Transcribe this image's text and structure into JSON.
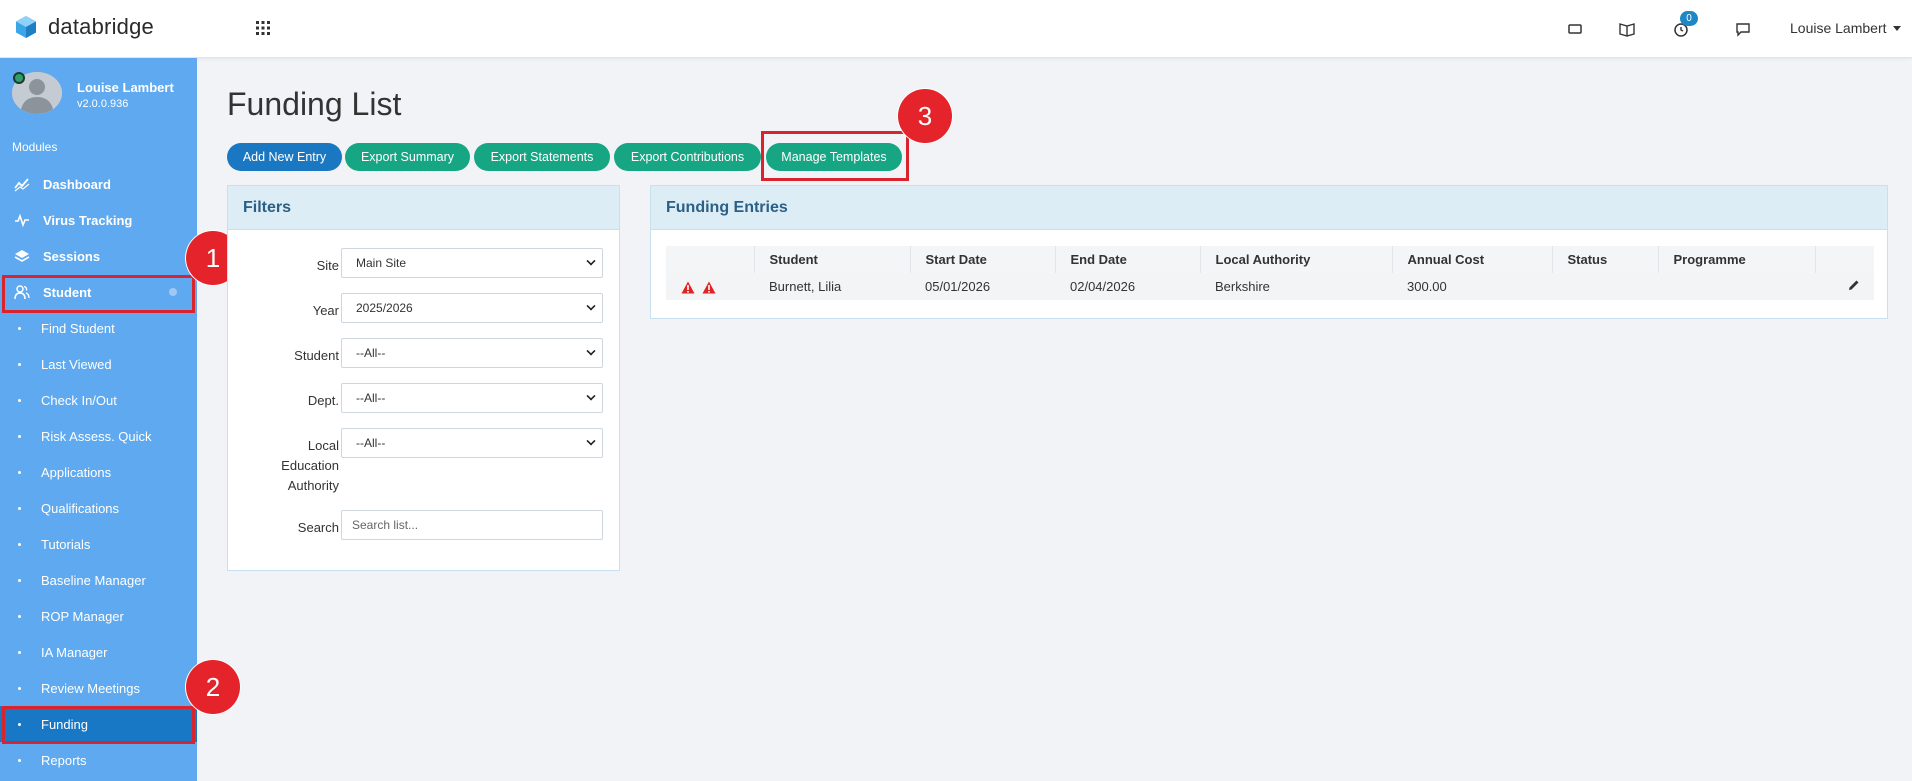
{
  "app": {
    "name": "databridge"
  },
  "topbar": {
    "notification_count": "0",
    "user_name": "Louise Lambert"
  },
  "sidebar": {
    "profile_name": "Louise Lambert",
    "version": "v2.0.0.936",
    "modules_label": "Modules",
    "items": [
      {
        "label": "Dashboard",
        "icon": "chart-line-icon"
      },
      {
        "label": "Virus Tracking",
        "icon": "pulse-icon"
      },
      {
        "label": "Sessions",
        "icon": "layers-icon"
      },
      {
        "label": "Student",
        "icon": "users-icon"
      }
    ],
    "sub_items": [
      "Find Student",
      "Last Viewed",
      "Check In/Out",
      "Risk Assess. Quick",
      "Applications",
      "Qualifications",
      "Tutorials",
      "Baseline Manager",
      "ROP Manager",
      "IA Manager",
      "Review Meetings",
      "Funding",
      "Reports"
    ]
  },
  "annotations": {
    "m1": "1",
    "m2": "2",
    "m3": "3"
  },
  "main": {
    "title": "Funding List",
    "buttons": {
      "add": "Add New Entry",
      "export_summary": "Export Summary",
      "export_statements": "Export Statements",
      "export_contributions": "Export Contributions",
      "manage_templates": "Manage Templates"
    }
  },
  "filters": {
    "title": "Filters",
    "site_label": "Site",
    "site_value": "Main Site",
    "year_label": "Year",
    "year_value": "2025/2026",
    "student_label": "Student",
    "student_value": "--All--",
    "dept_label": "Dept.",
    "dept_value": "--All--",
    "lea_label_1": "Local",
    "lea_label_2": "Education",
    "lea_label_3": "Authority",
    "lea_value": "--All--",
    "search_label": "Search",
    "search_placeholder": "Search list..."
  },
  "entries": {
    "title": "Funding Entries",
    "columns": [
      "",
      "Student",
      "Start Date",
      "End Date",
      "Local Authority",
      "Annual Cost",
      "Status",
      "Programme",
      ""
    ],
    "rows": [
      {
        "student": "Burnett, Lilia",
        "start_date": "05/01/2026",
        "end_date": "02/04/2026",
        "local_authority": "Berkshire",
        "annual_cost": "300.00",
        "status": "",
        "programme": ""
      }
    ]
  },
  "colors": {
    "sidebar": "#5ea9ef",
    "active_nav": "#1878c5",
    "primary_button": "#1a78c2",
    "success_button": "#16a683",
    "highlight": "#d9232d"
  }
}
